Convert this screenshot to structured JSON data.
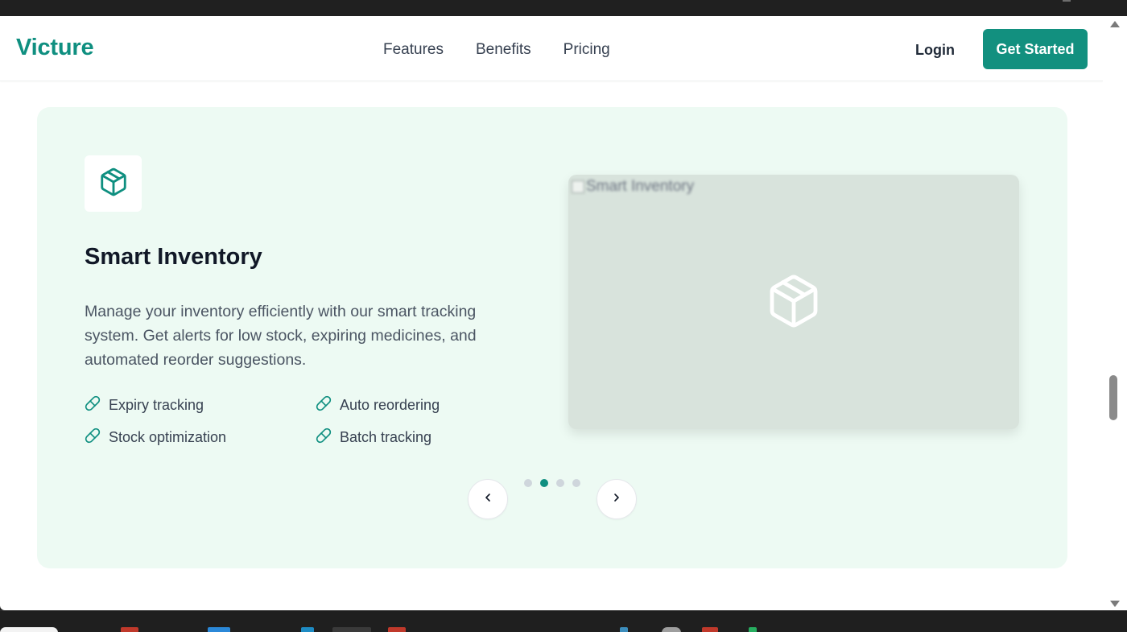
{
  "header": {
    "brand": "Victure",
    "nav": [
      "Features",
      "Benefits",
      "Pricing"
    ],
    "login_label": "Login",
    "cta_label": "Get Started"
  },
  "feature": {
    "icon": "package-icon",
    "title": "Smart Inventory",
    "description": "Manage your inventory efficiently with our smart tracking system. Get alerts for low stock, expiring medicines, and automated reorder suggestions.",
    "bullets": [
      "Expiry tracking",
      "Auto reordering",
      "Stock optimization",
      "Batch tracking"
    ],
    "bullet_icon": "pill-icon",
    "image_alt": "Smart Inventory"
  },
  "carousel": {
    "slide_count": 4,
    "active_index": 1,
    "prev_icon": "chevron-left-icon",
    "next_icon": "chevron-right-icon"
  },
  "colors": {
    "brand": "#0f8f80",
    "card_background": "#edfaf3",
    "preview_background": "#d8e3dc"
  }
}
